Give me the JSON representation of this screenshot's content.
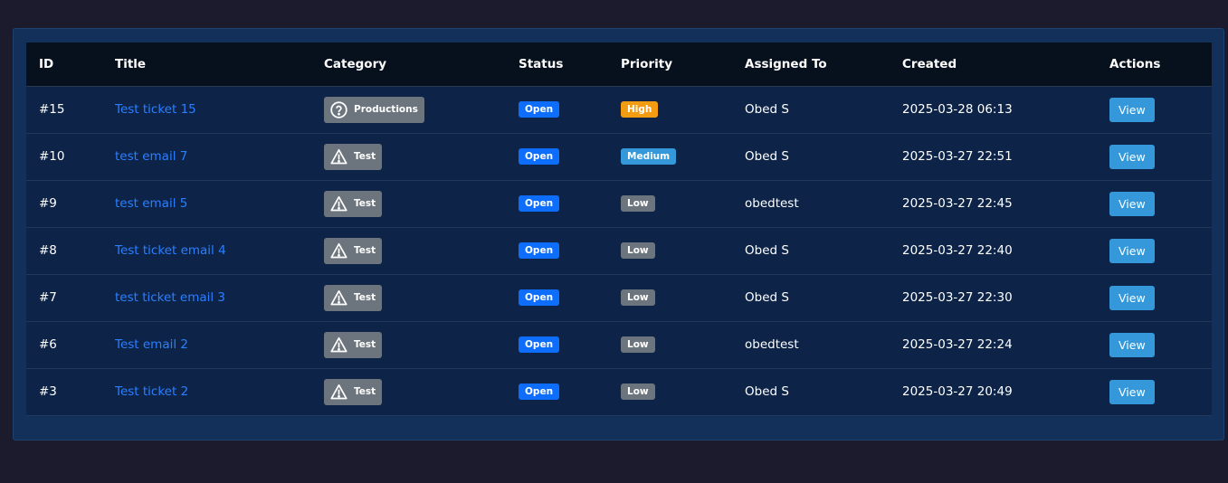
{
  "table": {
    "headers": {
      "id": "ID",
      "title": "Title",
      "category": "Category",
      "status": "Status",
      "priority": "Priority",
      "assigned": "Assigned To",
      "created": "Created",
      "actions": "Actions"
    },
    "rows": [
      {
        "id": "#15",
        "title": "Test ticket 15",
        "category": "Productions",
        "category_icon": "question-circle-icon",
        "status": "Open",
        "priority": "High",
        "priority_color": "#f39c12",
        "assigned": "Obed S",
        "created": "2025-03-28 06:13",
        "action": "View"
      },
      {
        "id": "#10",
        "title": "test email 7",
        "category": "Test",
        "category_icon": "warning-triangle-icon",
        "status": "Open",
        "priority": "Medium",
        "priority_color": "#3498db",
        "assigned": "Obed S",
        "created": "2025-03-27 22:51",
        "action": "View"
      },
      {
        "id": "#9",
        "title": "test email 5",
        "category": "Test",
        "category_icon": "warning-triangle-icon",
        "status": "Open",
        "priority": "Low",
        "priority_color": "#6c757d",
        "assigned": "obedtest",
        "created": "2025-03-27 22:45",
        "action": "View"
      },
      {
        "id": "#8",
        "title": "Test ticket email 4",
        "category": "Test",
        "category_icon": "warning-triangle-icon",
        "status": "Open",
        "priority": "Low",
        "priority_color": "#6c757d",
        "assigned": "Obed S",
        "created": "2025-03-27 22:40",
        "action": "View"
      },
      {
        "id": "#7",
        "title": "test ticket email 3",
        "category": "Test",
        "category_icon": "warning-triangle-icon",
        "status": "Open",
        "priority": "Low",
        "priority_color": "#6c757d",
        "assigned": "Obed S",
        "created": "2025-03-27 22:30",
        "action": "View"
      },
      {
        "id": "#6",
        "title": "Test email 2",
        "category": "Test",
        "category_icon": "warning-triangle-icon",
        "status": "Open",
        "priority": "Low",
        "priority_color": "#6c757d",
        "assigned": "obedtest",
        "created": "2025-03-27 22:24",
        "action": "View"
      },
      {
        "id": "#3",
        "title": "Test ticket 2",
        "category": "Test",
        "category_icon": "warning-triangle-icon",
        "status": "Open",
        "priority": "Low",
        "priority_color": "#6c757d",
        "assigned": "Obed S",
        "created": "2025-03-27 20:49",
        "action": "View"
      }
    ]
  },
  "colors": {
    "background": "#1c1b2e",
    "panel": "#12305a",
    "header_row": "#07111e",
    "body_row": "#0d2448",
    "link": "#2b7fff",
    "status_open": "#0d6efd",
    "view_button": "#3498db"
  }
}
